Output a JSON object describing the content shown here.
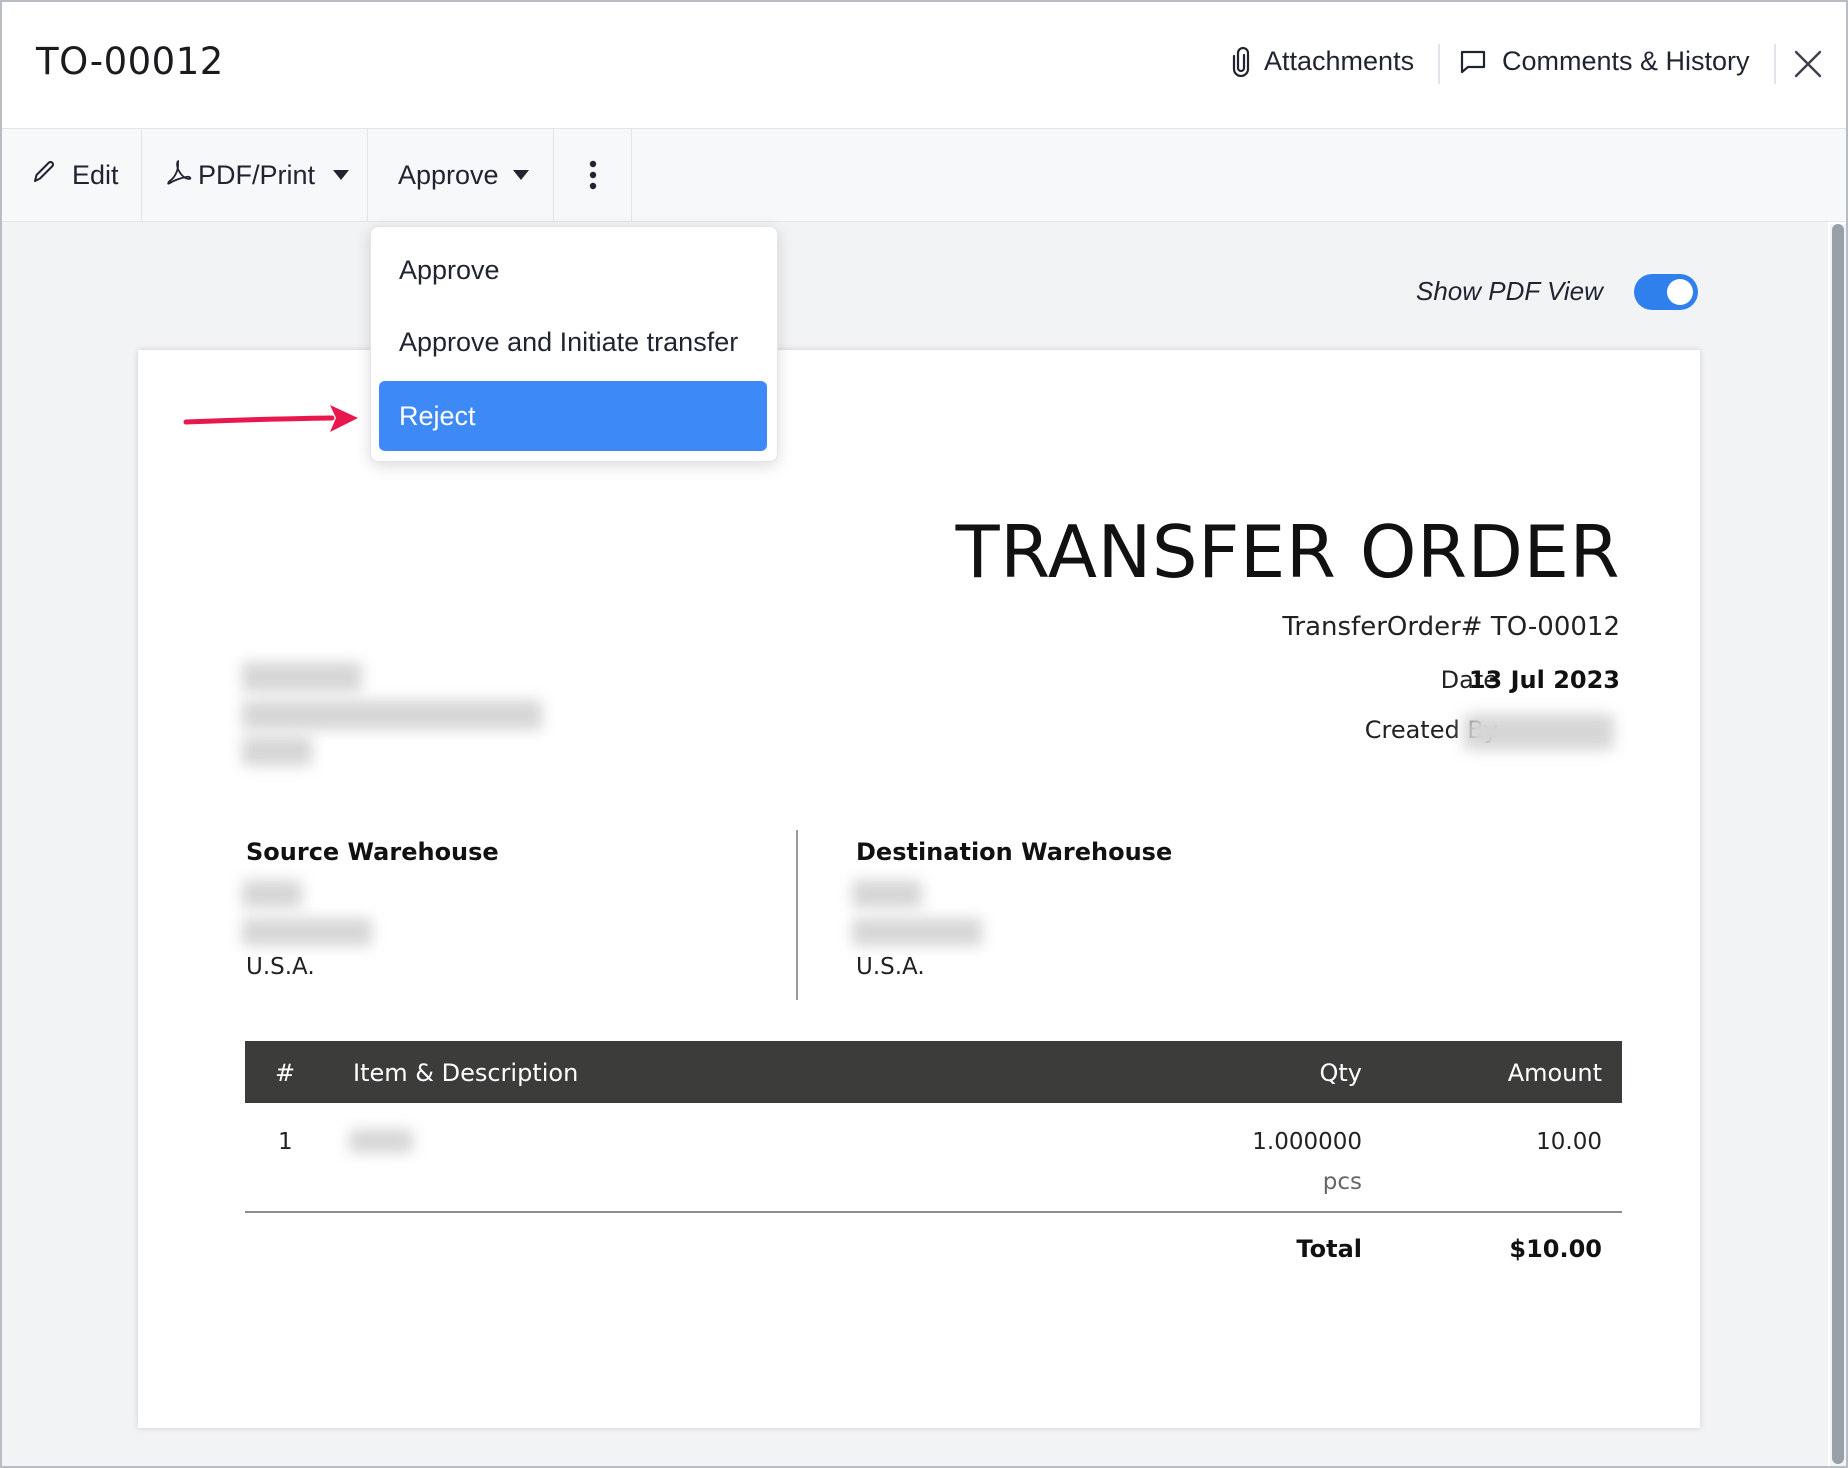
{
  "header": {
    "title": "TO-00012",
    "attachments_label": "Attachments",
    "comments_label": "Comments & History"
  },
  "toolbar": {
    "edit_label": "Edit",
    "pdf_print_label": "PDF/Print",
    "approve_label": "Approve"
  },
  "approve_menu": {
    "items": [
      "Approve",
      "Approve and Initiate transfer",
      "Reject"
    ],
    "highlighted": "Reject"
  },
  "pdf_view": {
    "label": "Show PDF View",
    "enabled": true
  },
  "document": {
    "heading": "TRANSFER ORDER",
    "number": "TransferOrder# TO-00012",
    "date_label": "Date",
    "date_value": "13 Jul 2023",
    "created_by_label": "Created By",
    "source_label": "Source Warehouse",
    "source_country": "U.S.A.",
    "destination_label": "Destination Warehouse",
    "destination_country": "U.S.A.",
    "table": {
      "columns": [
        "#",
        "Item & Description",
        "Qty",
        "Amount"
      ],
      "rows": [
        {
          "index": "1",
          "qty": "1.000000",
          "unit": "pcs",
          "amount": "10.00"
        }
      ],
      "total_label": "Total",
      "total_value": "$10.00"
    }
  },
  "colors": {
    "accent": "#3d8af7",
    "toggle": "#2f80ed",
    "annotation_arrow": "#e8174e",
    "table_header": "#3c3c3a"
  }
}
